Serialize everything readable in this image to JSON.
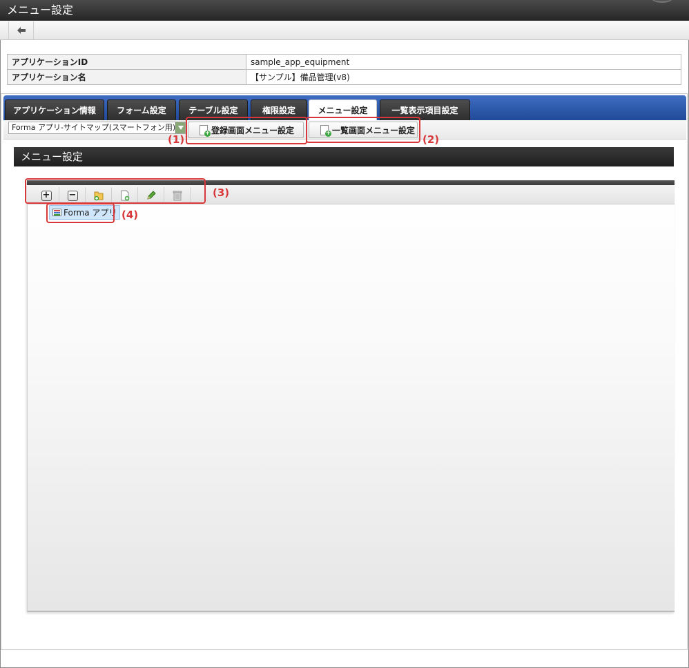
{
  "window": {
    "title": "メニュー設定"
  },
  "info": {
    "app_id_label": "アプリケーションID",
    "app_id_value": "sample_app_equipment",
    "app_name_label": "アプリケーション名",
    "app_name_value": "【サンプル】備品管理(v8)"
  },
  "tabs": [
    {
      "label": "アプリケーション情報"
    },
    {
      "label": "フォーム設定"
    },
    {
      "label": "テーブル設定"
    },
    {
      "label": "権限設定"
    },
    {
      "label": "メニュー設定",
      "active": true
    },
    {
      "label": "一覧表示項目設定"
    }
  ],
  "subbar": {
    "select_value": "Forma アプリ-サイトマップ(スマートフォン用)",
    "register_menu_button": "登録画面メニュー設定",
    "list_menu_button": "一覧画面メニュー設定"
  },
  "section": {
    "title": "メニュー設定"
  },
  "tree": {
    "root_label": "Forma アプリ"
  },
  "annotations": {
    "a1": "(1)",
    "a2": "(2)",
    "a3": "(3)",
    "a4": "(4)"
  },
  "colors": {
    "tab_bar": "#2e5aae",
    "annotation": "#d9383a",
    "tree_selection": "#cfe6fb",
    "dark_header": "#2a2a2a"
  }
}
